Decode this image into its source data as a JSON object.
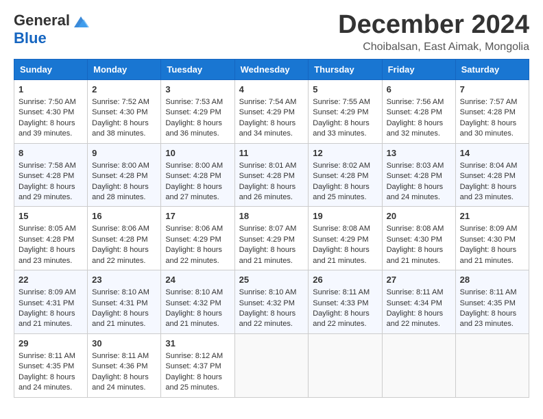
{
  "header": {
    "logo_general": "General",
    "logo_blue": "Blue",
    "month_title": "December 2024",
    "location": "Choibalsan, East Aimak, Mongolia"
  },
  "days_of_week": [
    "Sunday",
    "Monday",
    "Tuesday",
    "Wednesday",
    "Thursday",
    "Friday",
    "Saturday"
  ],
  "weeks": [
    [
      {
        "day": 1,
        "lines": [
          "Sunrise: 7:50 AM",
          "Sunset: 4:30 PM",
          "Daylight: 8 hours",
          "and 39 minutes."
        ]
      },
      {
        "day": 2,
        "lines": [
          "Sunrise: 7:52 AM",
          "Sunset: 4:30 PM",
          "Daylight: 8 hours",
          "and 38 minutes."
        ]
      },
      {
        "day": 3,
        "lines": [
          "Sunrise: 7:53 AM",
          "Sunset: 4:29 PM",
          "Daylight: 8 hours",
          "and 36 minutes."
        ]
      },
      {
        "day": 4,
        "lines": [
          "Sunrise: 7:54 AM",
          "Sunset: 4:29 PM",
          "Daylight: 8 hours",
          "and 34 minutes."
        ]
      },
      {
        "day": 5,
        "lines": [
          "Sunrise: 7:55 AM",
          "Sunset: 4:29 PM",
          "Daylight: 8 hours",
          "and 33 minutes."
        ]
      },
      {
        "day": 6,
        "lines": [
          "Sunrise: 7:56 AM",
          "Sunset: 4:28 PM",
          "Daylight: 8 hours",
          "and 32 minutes."
        ]
      },
      {
        "day": 7,
        "lines": [
          "Sunrise: 7:57 AM",
          "Sunset: 4:28 PM",
          "Daylight: 8 hours",
          "and 30 minutes."
        ]
      }
    ],
    [
      {
        "day": 8,
        "lines": [
          "Sunrise: 7:58 AM",
          "Sunset: 4:28 PM",
          "Daylight: 8 hours",
          "and 29 minutes."
        ]
      },
      {
        "day": 9,
        "lines": [
          "Sunrise: 8:00 AM",
          "Sunset: 4:28 PM",
          "Daylight: 8 hours",
          "and 28 minutes."
        ]
      },
      {
        "day": 10,
        "lines": [
          "Sunrise: 8:00 AM",
          "Sunset: 4:28 PM",
          "Daylight: 8 hours",
          "and 27 minutes."
        ]
      },
      {
        "day": 11,
        "lines": [
          "Sunrise: 8:01 AM",
          "Sunset: 4:28 PM",
          "Daylight: 8 hours",
          "and 26 minutes."
        ]
      },
      {
        "day": 12,
        "lines": [
          "Sunrise: 8:02 AM",
          "Sunset: 4:28 PM",
          "Daylight: 8 hours",
          "and 25 minutes."
        ]
      },
      {
        "day": 13,
        "lines": [
          "Sunrise: 8:03 AM",
          "Sunset: 4:28 PM",
          "Daylight: 8 hours",
          "and 24 minutes."
        ]
      },
      {
        "day": 14,
        "lines": [
          "Sunrise: 8:04 AM",
          "Sunset: 4:28 PM",
          "Daylight: 8 hours",
          "and 23 minutes."
        ]
      }
    ],
    [
      {
        "day": 15,
        "lines": [
          "Sunrise: 8:05 AM",
          "Sunset: 4:28 PM",
          "Daylight: 8 hours",
          "and 23 minutes."
        ]
      },
      {
        "day": 16,
        "lines": [
          "Sunrise: 8:06 AM",
          "Sunset: 4:28 PM",
          "Daylight: 8 hours",
          "and 22 minutes."
        ]
      },
      {
        "day": 17,
        "lines": [
          "Sunrise: 8:06 AM",
          "Sunset: 4:29 PM",
          "Daylight: 8 hours",
          "and 22 minutes."
        ]
      },
      {
        "day": 18,
        "lines": [
          "Sunrise: 8:07 AM",
          "Sunset: 4:29 PM",
          "Daylight: 8 hours",
          "and 21 minutes."
        ]
      },
      {
        "day": 19,
        "lines": [
          "Sunrise: 8:08 AM",
          "Sunset: 4:29 PM",
          "Daylight: 8 hours",
          "and 21 minutes."
        ]
      },
      {
        "day": 20,
        "lines": [
          "Sunrise: 8:08 AM",
          "Sunset: 4:30 PM",
          "Daylight: 8 hours",
          "and 21 minutes."
        ]
      },
      {
        "day": 21,
        "lines": [
          "Sunrise: 8:09 AM",
          "Sunset: 4:30 PM",
          "Daylight: 8 hours",
          "and 21 minutes."
        ]
      }
    ],
    [
      {
        "day": 22,
        "lines": [
          "Sunrise: 8:09 AM",
          "Sunset: 4:31 PM",
          "Daylight: 8 hours",
          "and 21 minutes."
        ]
      },
      {
        "day": 23,
        "lines": [
          "Sunrise: 8:10 AM",
          "Sunset: 4:31 PM",
          "Daylight: 8 hours",
          "and 21 minutes."
        ]
      },
      {
        "day": 24,
        "lines": [
          "Sunrise: 8:10 AM",
          "Sunset: 4:32 PM",
          "Daylight: 8 hours",
          "and 21 minutes."
        ]
      },
      {
        "day": 25,
        "lines": [
          "Sunrise: 8:10 AM",
          "Sunset: 4:32 PM",
          "Daylight: 8 hours",
          "and 22 minutes."
        ]
      },
      {
        "day": 26,
        "lines": [
          "Sunrise: 8:11 AM",
          "Sunset: 4:33 PM",
          "Daylight: 8 hours",
          "and 22 minutes."
        ]
      },
      {
        "day": 27,
        "lines": [
          "Sunrise: 8:11 AM",
          "Sunset: 4:34 PM",
          "Daylight: 8 hours",
          "and 22 minutes."
        ]
      },
      {
        "day": 28,
        "lines": [
          "Sunrise: 8:11 AM",
          "Sunset: 4:35 PM",
          "Daylight: 8 hours",
          "and 23 minutes."
        ]
      }
    ],
    [
      {
        "day": 29,
        "lines": [
          "Sunrise: 8:11 AM",
          "Sunset: 4:35 PM",
          "Daylight: 8 hours",
          "and 24 minutes."
        ]
      },
      {
        "day": 30,
        "lines": [
          "Sunrise: 8:11 AM",
          "Sunset: 4:36 PM",
          "Daylight: 8 hours",
          "and 24 minutes."
        ]
      },
      {
        "day": 31,
        "lines": [
          "Sunrise: 8:12 AM",
          "Sunset: 4:37 PM",
          "Daylight: 8 hours",
          "and 25 minutes."
        ]
      },
      null,
      null,
      null,
      null
    ]
  ]
}
